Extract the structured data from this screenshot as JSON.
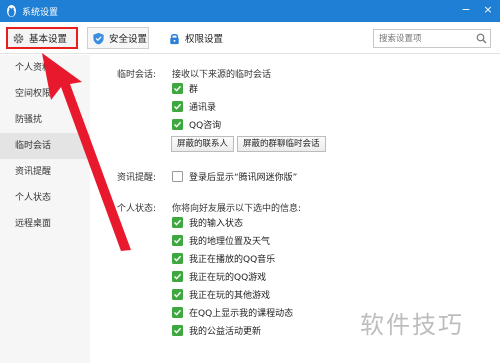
{
  "window": {
    "title": "系统设置",
    "minimize": "−",
    "close": "×"
  },
  "toolbar": {
    "tabs": [
      {
        "label": "基本设置",
        "icon": "gear-icon"
      },
      {
        "label": "安全设置",
        "icon": "shield-icon"
      },
      {
        "label": "权限设置",
        "icon": "lock-icon"
      }
    ],
    "search": {
      "placeholder": "搜索设置项",
      "icon": "search-icon"
    }
  },
  "sidebar": {
    "items": [
      {
        "label": "个人资料"
      },
      {
        "label": "空间权限"
      },
      {
        "label": "防骚扰"
      },
      {
        "label": "临时会话",
        "active": true
      },
      {
        "label": "资讯提醒"
      },
      {
        "label": "个人状态"
      },
      {
        "label": "远程桌面"
      }
    ]
  },
  "temp_session": {
    "label": "临时会话:",
    "desc": "接收以下来源的临时会话",
    "options": [
      {
        "label": "群",
        "checked": true
      },
      {
        "label": "通讯录",
        "checked": true
      },
      {
        "label": "QQ咨询",
        "checked": true
      }
    ],
    "blocked_contacts_button": "屏蔽的联系人",
    "blocked_group_button": "屏蔽的群聊临时会话"
  },
  "news": {
    "label": "资讯提醒:",
    "option": {
      "label": "登录后显示“腾讯网迷你版”",
      "checked": false
    }
  },
  "status": {
    "label": "个人状态:",
    "desc": "你将向好友展示以下选中的信息:",
    "options": [
      {
        "label": "我的输入状态",
        "checked": true
      },
      {
        "label": "我的地理位置及天气",
        "checked": true
      },
      {
        "label": "我正在播放的QQ音乐",
        "checked": true
      },
      {
        "label": "我正在玩的QQ游戏",
        "checked": true
      },
      {
        "label": "我正在玩的其他游戏",
        "checked": true
      },
      {
        "label": "在QQ上显示我的课程动态",
        "checked": true
      },
      {
        "label": "我的公益活动更新",
        "checked": true
      }
    ]
  },
  "watermark": "软件技巧",
  "colors": {
    "titlebar": "#1f7fd4",
    "checkbox": "#3da83d",
    "highlight": "#e61e1e"
  }
}
